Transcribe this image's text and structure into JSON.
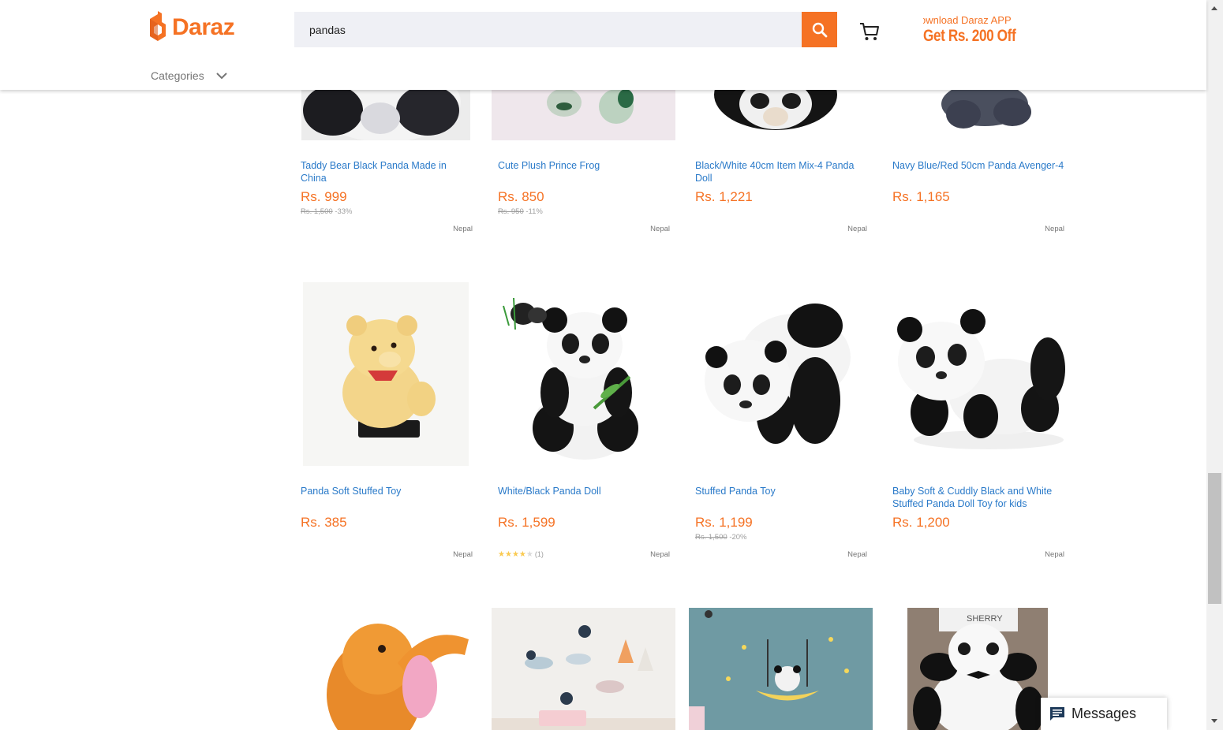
{
  "brand": {
    "name": "Daraz",
    "color": "#f57224"
  },
  "search": {
    "value": "pandas"
  },
  "promo": {
    "line1": "ownload Daraz APP",
    "line2": "Get Rs. 200 Off"
  },
  "nav": {
    "categories": "Categories"
  },
  "products": [
    {
      "title": "Taddy Bear Black Panda Made in China",
      "price": "Rs. 999",
      "original": "Rs. 1,500",
      "discount": "-33%",
      "location": "Nepal"
    },
    {
      "title": "Cute Plush Prince Frog",
      "price": "Rs. 850",
      "original": "Rs. 950",
      "discount": "-11%",
      "location": "Nepal"
    },
    {
      "title": "Black/White 40cm Item Mix-4 Panda Doll",
      "price": "Rs. 1,221",
      "location": "Nepal"
    },
    {
      "title": "Navy Blue/Red 50cm Panda Avenger-4",
      "price": "Rs. 1,165",
      "location": "Nepal"
    },
    {
      "title": "Panda Soft Stuffed Toy",
      "price": "Rs. 385",
      "location": "Nepal"
    },
    {
      "title": "White/Black Panda Doll",
      "price": "Rs. 1,599",
      "rating": 4,
      "rating_count": "(1)",
      "location": "Nepal"
    },
    {
      "title": "Stuffed Panda Toy",
      "price": "Rs. 1,199",
      "original": "Rs. 1,500",
      "discount": "-20%",
      "location": "Nepal"
    },
    {
      "title": "Baby Soft & Cuddly Black and White Stuffed Panda Doll Toy for kids",
      "price": "Rs. 1,200",
      "location": "Nepal"
    }
  ],
  "image_labels": {
    "sherry": "SHERRY"
  },
  "messages": {
    "label": "Messages"
  }
}
